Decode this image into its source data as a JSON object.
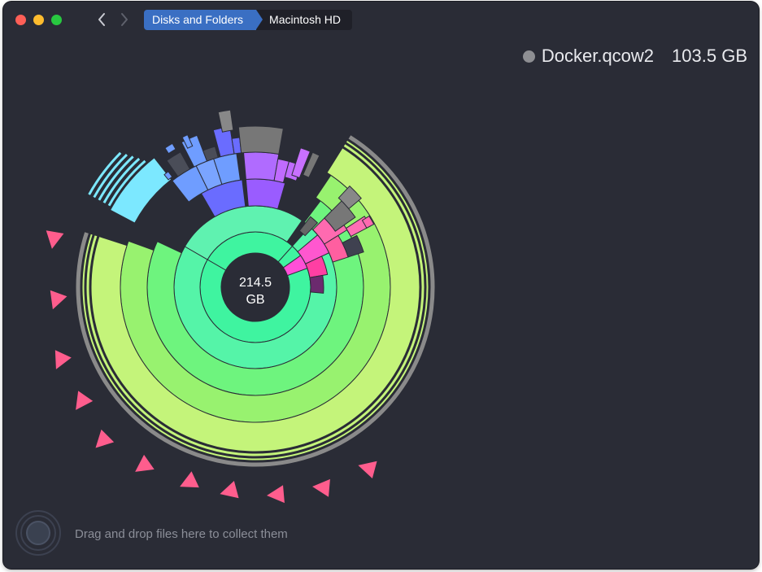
{
  "window": {
    "controls": {
      "close": "#fe5f57",
      "minimize": "#febc2e",
      "zoom": "#28c840"
    }
  },
  "toolbar": {
    "back_icon": "chevron-left-icon",
    "forward_icon": "chevron-right-icon",
    "breadcrumbs": [
      "Disks and Folders",
      "Macintosh HD"
    ]
  },
  "selection": {
    "name": "Docker.qcow2",
    "size": "103.5 GB",
    "dot_color": "#8e8f93"
  },
  "center": {
    "size_value": "214.5",
    "size_unit": "GB"
  },
  "drop_zone": {
    "icon": "collector-icon",
    "text": "Drag and drop files here to collect them"
  },
  "legend_colors": {
    "green_light": "#c4f47a",
    "green": "#7cf070",
    "teal": "#3ff4a0",
    "cyan": "#7ce8ff",
    "blue": "#6f9dff",
    "violet": "#7575ff",
    "purple": "#b06bff",
    "magenta": "#ff4fd8",
    "pink": "#ff6ab0",
    "gray": "#7a7a7a",
    "marker": "#ff5d8d"
  }
}
